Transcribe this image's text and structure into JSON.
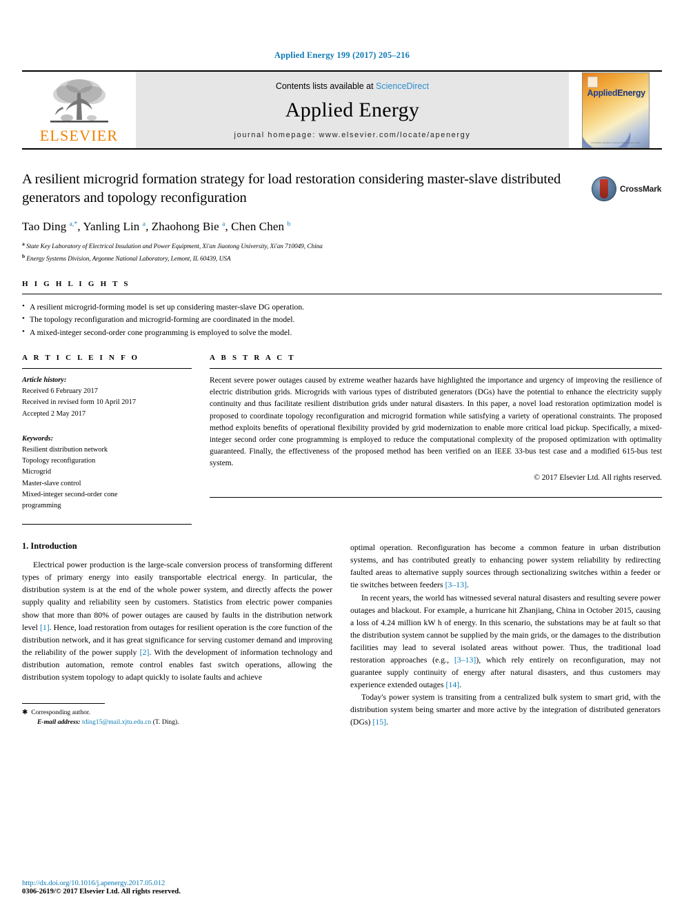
{
  "running_head": "Applied Energy 199 (2017) 205–216",
  "masthead": {
    "publisher": "ELSEVIER",
    "contents_prefix": "Contents lists available at ",
    "contents_link": "ScienceDirect",
    "journal_title": "Applied Energy",
    "homepage": "journal homepage: www.elsevier.com/locate/apenergy",
    "cover_title_a": "Applied",
    "cover_title_b": "Energy",
    "cover_footer": "available online at www.sciencedirect.com"
  },
  "article": {
    "title": "A resilient microgrid formation strategy for load restoration considering master-slave distributed generators and topology reconfiguration",
    "crossmark_label": "CrossMark",
    "authors_html": "Tao Ding <sup>a,*</sup>, Yanling Lin <sup>a</sup>, Zhaohong Bie <sup>a</sup>, Chen Chen <sup>b</sup>",
    "authors_plain": "Tao Ding a,*, Yanling Lin a, Zhaohong Bie a, Chen Chen b",
    "affiliations": [
      {
        "marker": "a",
        "text": "State Key Laboratory of Electrical Insulation and Power Equipment, Xi'an Jiaotong University, Xi'an 710049, China"
      },
      {
        "marker": "b",
        "text": "Energy Systems Division, Argonne National Laboratory, Lemont, IL 60439, USA"
      }
    ]
  },
  "highlights": {
    "label": "H I G H L I G H T S",
    "items": [
      "A resilient microgrid-forming model is set up considering master-slave DG operation.",
      "The topology reconfiguration and microgrid-forming are coordinated in the model.",
      "A mixed-integer second-order cone programming is employed to solve the model."
    ]
  },
  "article_info": {
    "label": "A R T I C L E    I N F O",
    "history_title": "Article history:",
    "history": [
      "Received 6 February 2017",
      "Received in revised form 10 April 2017",
      "Accepted 2 May 2017"
    ],
    "keywords_title": "Keywords:",
    "keywords": [
      "Resilient distribution network",
      "Topology reconfiguration",
      "Microgrid",
      "Master-slave control",
      "Mixed-integer second-order cone",
      "programming"
    ]
  },
  "abstract": {
    "label": "A B S T R A C T",
    "text": "Recent severe power outages caused by extreme weather hazards have highlighted the importance and urgency of improving the resilience of electric distribution grids. Microgrids with various types of distributed generators (DGs) have the potential to enhance the electricity supply continuity and thus facilitate resilient distribution grids under natural disasters. In this paper, a novel load restoration optimization model is proposed to coordinate topology reconfiguration and microgrid formation while satisfying a variety of operational constraints. The proposed method exploits benefits of operational flexibility provided by grid modernization to enable more critical load pickup. Specifically, a mixed-integer second order cone programming is employed to reduce the computational complexity of the proposed optimization with optimality guaranteed. Finally, the effectiveness of the proposed method has been verified on an IEEE 33-bus test case and a modified 615-bus test system.",
    "copyright": "© 2017 Elsevier Ltd. All rights reserved."
  },
  "introduction": {
    "heading": "1. Introduction",
    "left_paragraphs": [
      "Electrical power production is the large-scale conversion process of transforming different types of primary energy into easily transportable electrical energy. In particular, the distribution system is at the end of the whole power system, and directly affects the power supply quality and reliability seen by customers. Statistics from electric power companies show that more than 80% of power outages are caused by faults in the distribution network level [1]. Hence, load restoration from outages for resilient operation is the core function of the distribution network, and it has great significance for serving customer demand and improving the reliability of the power supply [2]. With the development of information technology and distribution automation, remote control enables fast switch operations, allowing the distribution system topology to adapt quickly to isolate faults and achieve"
    ],
    "right_paragraphs": [
      "optimal operation. Reconfiguration has become a common feature in urban distribution systems, and has contributed greatly to enhancing power system reliability by redirecting faulted areas to alternative supply sources through sectionalizing switches within a feeder or tie switches between feeders [3–13].",
      "In recent years, the world has witnessed several natural disasters and resulting severe power outages and blackout. For example, a hurricane hit Zhanjiang, China in October 2015, causing a loss of 4.24 million kW h of energy. In this scenario, the substations may be at fault so that the distribution system cannot be supplied by the main grids, or the damages to the distribution facilities may lead to several isolated areas without power. Thus, the traditional load restoration approaches (e.g., [3–13]), which rely entirely on reconfiguration, may not guarantee supply continuity of energy after natural disasters, and thus customers may experience extended outages [14].",
      "Today's power system is transiting from a centralized bulk system to smart grid, with the distribution system being smarter and more active by the integration of distributed generators (DGs) [15]."
    ]
  },
  "footnote": {
    "corresponding": "Corresponding author.",
    "email_label": "E-mail address:",
    "email": "tding15@mail.xjtu.edu.cn",
    "email_suffix": "(T. Ding)."
  },
  "footer": {
    "doi": "http://dx.doi.org/10.1016/j.apenergy.2017.05.012",
    "issn": "0306-2619/© 2017 Elsevier Ltd. All rights reserved."
  },
  "colors": {
    "link": "#0b7ab5",
    "sciencedirect": "#2a8fd0",
    "elsevier_orange": "#f08000",
    "masthead_bg": "#e6e6e6"
  }
}
